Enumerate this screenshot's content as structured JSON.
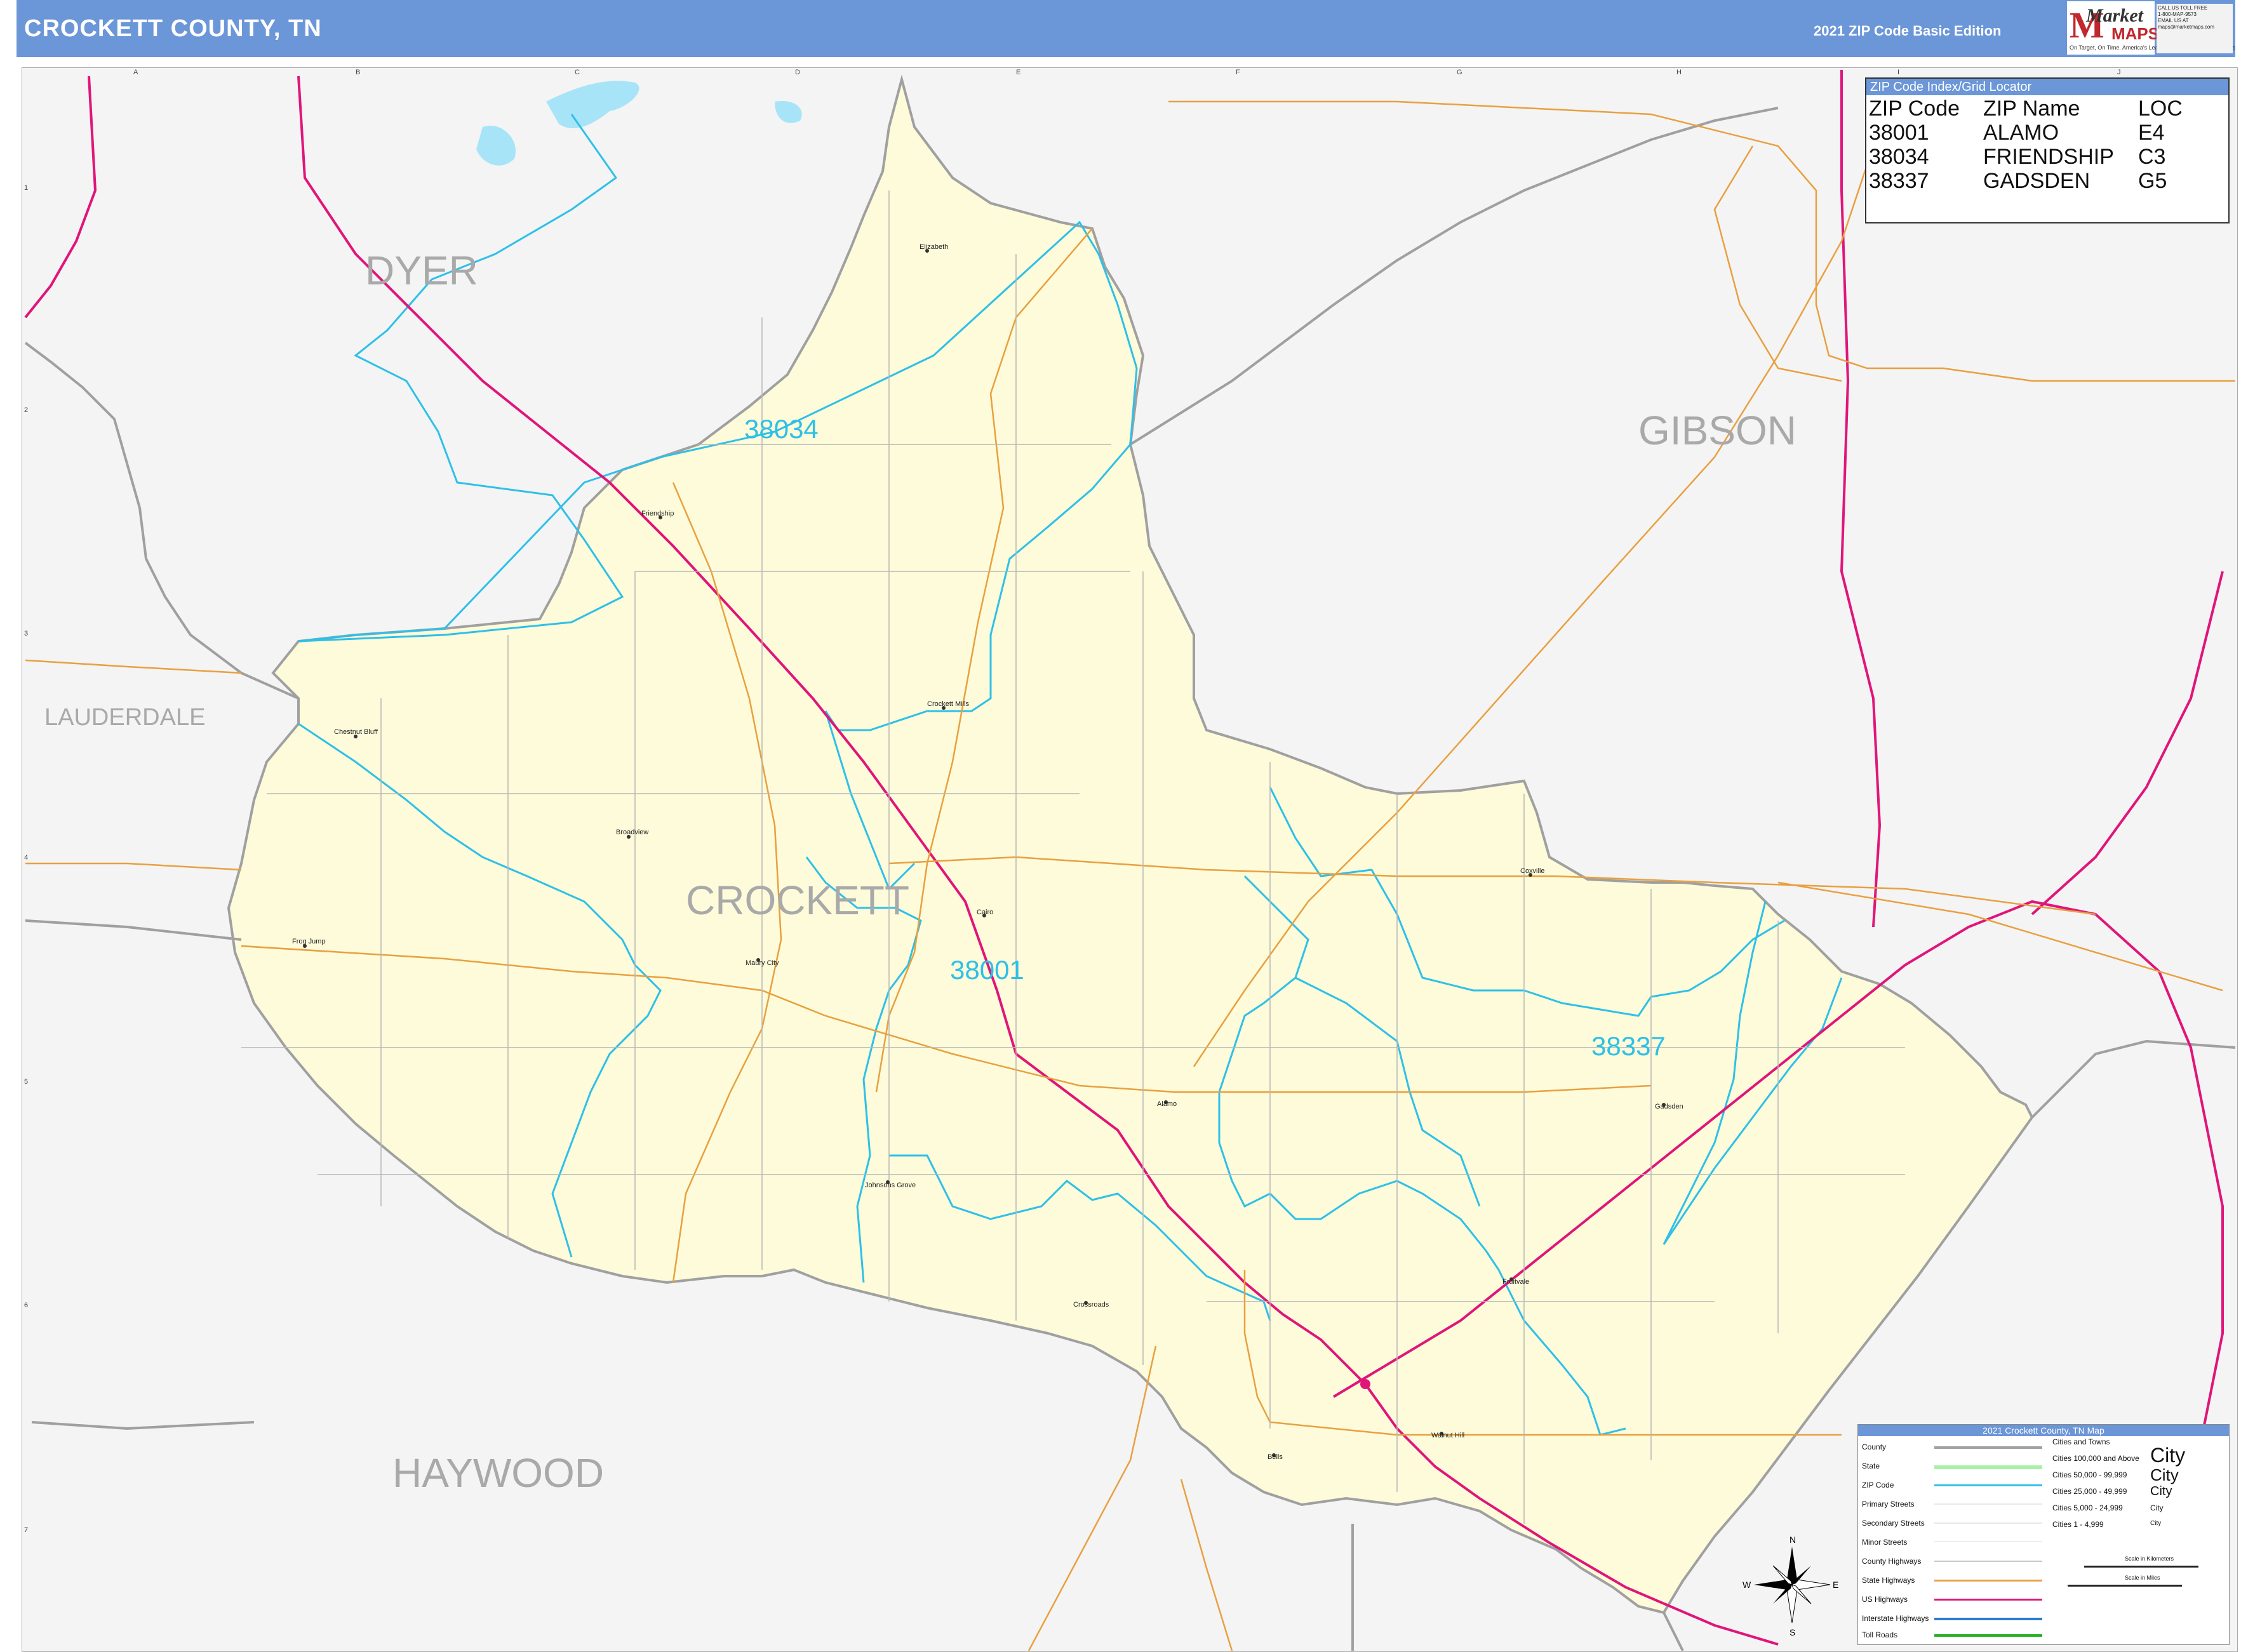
{
  "header": {
    "title": "CROCKETT COUNTY, TN",
    "edition": "2021 ZIP Code Basic Edition",
    "logo_main": "Market",
    "logo_sub": "MAPS",
    "logo_tag": "On Target, On Time. America's Leading Source of Business Maps"
  },
  "contact": {
    "line1": "CALL US TOLL FREE",
    "line2": "1-800-MAP-9573",
    "line3": "EMAIL US AT",
    "line4": "maps@marketmaps.com"
  },
  "counties": {
    "dyer": "DYER",
    "gibson": "GIBSON",
    "lauderdale": "LAUDERDALE",
    "crockett": "CROCKETT",
    "haywood": "HAYWOOD"
  },
  "zips": {
    "z38034": "38034",
    "z38001": "38001",
    "z38337": "38337"
  },
  "towns": {
    "elizabeth": "Elizabeth",
    "friendship": "Friendship",
    "crockett_mills": "Crockett Mills",
    "chestnut_bluff": "Chestnut Bluff",
    "broadview": "Broadview",
    "frog_jump": "Frog Jump",
    "maury_city": "Maury City",
    "cairo": "Cairo",
    "coxville": "Coxville",
    "alamo": "Alamo",
    "gadsden": "Gadsden",
    "johnsons_grove": "Johnsons Grove",
    "fruitvale": "Fruitvale",
    "crossroads": "Crossroads",
    "walnut_hill": "Walnut Hill",
    "bells": "Bells"
  },
  "index": {
    "title": "ZIP Code Index/Grid Locator",
    "headers": [
      "ZIP Code",
      "ZIP Name",
      "LOC"
    ],
    "rows": [
      [
        "38001",
        "ALAMO",
        "E4"
      ],
      [
        "38034",
        "FRIENDSHIP",
        "C3"
      ],
      [
        "38337",
        "GADSDEN",
        "G5"
      ]
    ]
  },
  "legend": {
    "title": "2021 Crockett County, TN Map",
    "items": [
      "County",
      "State",
      "ZIP Code",
      "Primary Streets",
      "Secondary Streets",
      "Minor Streets",
      "County Highways",
      "State Highways",
      "US Highways",
      "Interstate Highways",
      "Toll Roads"
    ],
    "cities_title": "Cities and Towns",
    "city_rows": [
      "Cities 100,000 and Above",
      "Cities 50,000 - 99,999",
      "Cities 25,000 - 49,999",
      "Cities 5,000 - 24,999",
      "Cities 1 - 4,999"
    ],
    "city_word": "City",
    "scale_km": "Scale in Kilometers",
    "scale_mi": "Scale in Miles"
  },
  "compass": {
    "n": "N",
    "s": "S",
    "e": "E",
    "w": "W"
  },
  "grid": {
    "cols": [
      "A",
      "B",
      "C",
      "D",
      "E",
      "F",
      "G",
      "H",
      "I",
      "J"
    ],
    "rows": [
      "1",
      "2",
      "3",
      "4",
      "5",
      "6",
      "7"
    ]
  },
  "colors": {
    "header": "#6b96d8",
    "county_fill": "#fdfbd9",
    "zip_line": "#2ec0e8",
    "us_highway": "#e0157a",
    "state_highway": "#e8a040",
    "county_border": "#a0a0a0",
    "water": "#a8e4f8"
  }
}
